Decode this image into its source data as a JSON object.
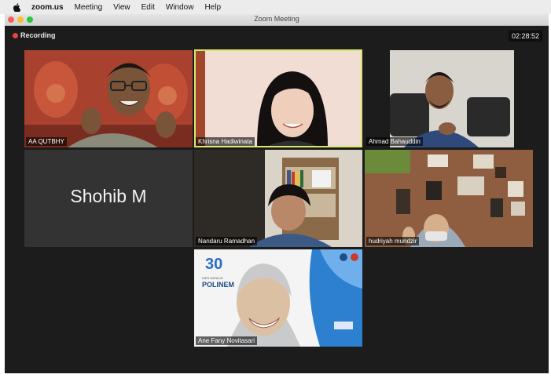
{
  "menubar": {
    "app": "zoom.us",
    "items": [
      "Meeting",
      "View",
      "Edit",
      "Window",
      "Help"
    ]
  },
  "window": {
    "title": "Zoom Meeting"
  },
  "status": {
    "recording_label": "Recording",
    "elapsed_time": "02:28:52"
  },
  "participants": [
    {
      "name": "AA QUTBHY",
      "video": "on",
      "speaking": false
    },
    {
      "name": "Khrisna Hadiwinata",
      "video": "on",
      "speaking": true
    },
    {
      "name": "Ahmad Bahauddin",
      "video": "on",
      "speaking": false
    },
    {
      "name": "Shohib M",
      "video": "off",
      "speaking": false
    },
    {
      "name": "Nandaru Ramadhan",
      "video": "on",
      "speaking": false
    },
    {
      "name": "hudriyah mundzir",
      "video": "on",
      "speaking": false
    },
    {
      "name": "Ane Fany Novitasari",
      "video": "on",
      "speaking": false
    }
  ],
  "background_poster": {
    "badge": "30",
    "caption": "DIES NATALIS",
    "name": "POLINEM"
  },
  "colors": {
    "recording_dot": "#e8443a",
    "active_speaker_outline": "#d8e86a",
    "meeting_bg": "#1c1c1c"
  }
}
